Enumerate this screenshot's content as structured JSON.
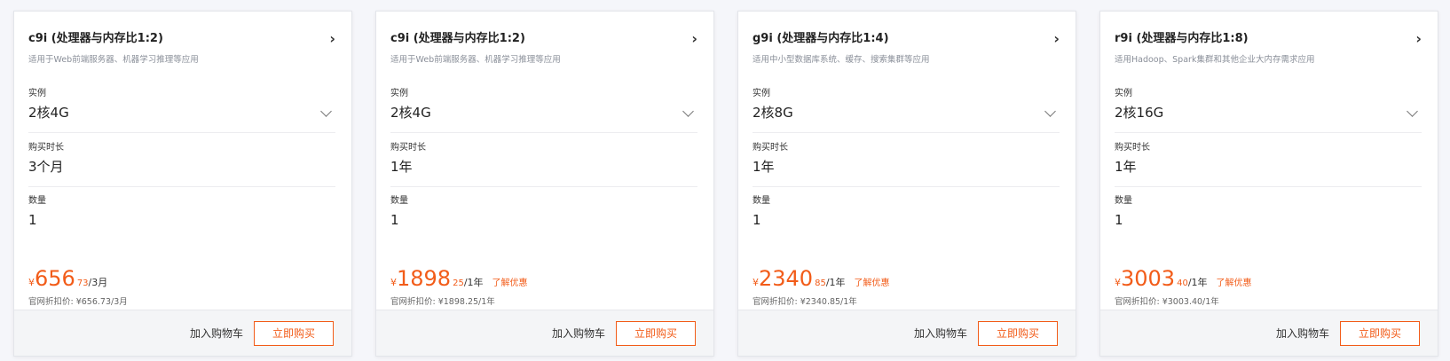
{
  "cards": [
    {
      "title": "c9i (处理器与内存比1:2)",
      "desc": "适用于Web前端服务器、机器学习推理等应用",
      "instance_label": "实例",
      "instance_value": "2核4G",
      "duration_label": "购买时长",
      "duration_value": "3个月",
      "quantity_label": "数量",
      "quantity_value": "1",
      "currency": "¥",
      "price_int": "656",
      "price_dec": "73",
      "price_unit": "/3月",
      "promo": "",
      "official": "官网折扣价: ¥656.73/3月",
      "cart_label": "加入购物车",
      "buy_label": "立即购买"
    },
    {
      "title": "c9i (处理器与内存比1:2)",
      "desc": "适用于Web前端服务器、机器学习推理等应用",
      "instance_label": "实例",
      "instance_value": "2核4G",
      "duration_label": "购买时长",
      "duration_value": "1年",
      "quantity_label": "数量",
      "quantity_value": "1",
      "currency": "¥",
      "price_int": "1898",
      "price_dec": "25",
      "price_unit": "/1年",
      "promo": "了解优惠",
      "official": "官网折扣价: ¥1898.25/1年",
      "cart_label": "加入购物车",
      "buy_label": "立即购买"
    },
    {
      "title": "g9i (处理器与内存比1:4)",
      "desc": "适用中小型数据库系统、缓存、搜索集群等应用",
      "instance_label": "实例",
      "instance_value": "2核8G",
      "duration_label": "购买时长",
      "duration_value": "1年",
      "quantity_label": "数量",
      "quantity_value": "1",
      "currency": "¥",
      "price_int": "2340",
      "price_dec": "85",
      "price_unit": "/1年",
      "promo": "了解优惠",
      "official": "官网折扣价: ¥2340.85/1年",
      "cart_label": "加入购物车",
      "buy_label": "立即购买"
    },
    {
      "title": "r9i (处理器与内存比1:8)",
      "desc": "适用Hadoop、Spark集群和其他企业大内存需求应用",
      "instance_label": "实例",
      "instance_value": "2核16G",
      "duration_label": "购买时长",
      "duration_value": "1年",
      "quantity_label": "数量",
      "quantity_value": "1",
      "currency": "¥",
      "price_int": "3003",
      "price_dec": "40",
      "price_unit": "/1年",
      "promo": "了解优惠",
      "official": "官网折扣价: ¥3003.40/1年",
      "cart_label": "加入购物车",
      "buy_label": "立即购买"
    }
  ],
  "icons": {
    "detail": "chevron-right-icon",
    "dropdown": "chevron-down-icon"
  },
  "colors": {
    "accent": "#f25c19",
    "card_bg": "#ffffff",
    "footer_bg": "#f4f5f7",
    "page_bg": "#f5f6fa"
  }
}
